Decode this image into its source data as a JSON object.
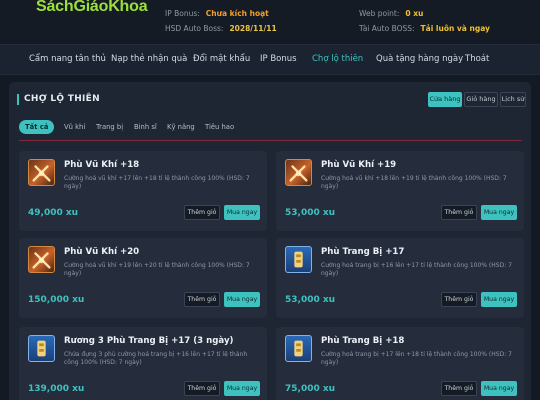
{
  "header": {
    "logo_text": "SáchGiáoKhoa",
    "ip_bonus_label": "IP Bonus:",
    "ip_bonus_value": "Chưa kích hoạt",
    "hsd_label": "HSD Auto Boss:",
    "hsd_value": "2028/11/11",
    "webpoint_label": "Web point:",
    "webpoint_value": "0 xu",
    "autoboss_label": "Tài Auto BOSS:",
    "autoboss_value": "Tải luôn và ngay"
  },
  "nav": {
    "items": [
      "Cẩm nang tân thủ",
      "Nạp thẻ nhận quà",
      "Đổi mật khẩu",
      "IP Bonus",
      "Chợ lộ thiên",
      "Quà tặng hàng ngày",
      "Thoát"
    ],
    "active": "Chợ lộ thiên"
  },
  "market": {
    "title": "CHỢ LỘ THIÊN",
    "tabs": [
      "Cửa hàng",
      "Giỏ hàng",
      "Lịch sử"
    ],
    "active_tab": "Cửa hàng",
    "filters": [
      "Tất cả",
      "Vũ khí",
      "Trang bị",
      "Binh sĩ",
      "Kỹ năng",
      "Tiêu hao"
    ],
    "active_filter": "Tất cả",
    "add_to_cart_label": "Thêm giỏ",
    "buy_label": "Mua ngay",
    "items": [
      {
        "name": "Phù Vũ Khí +18",
        "desc": "Cường hoá vũ khí +17 lên +18 tỉ lệ thành công 100% (HSD: 7 ngày)",
        "price": "49,000 xu",
        "icon": "sword-icon"
      },
      {
        "name": "Phù Vũ Khí +19",
        "desc": "Cường hoá vũ khí +18 lên +19 tỉ lệ thành công 100% (HSD: 7 ngày)",
        "price": "53,000 xu",
        "icon": "sword-icon"
      },
      {
        "name": "Phù Vũ Khí +20",
        "desc": "Cường hoá vũ khí +19 lên +20 tỉ lệ thành công 100% (HSD: 7 ngày)",
        "price": "150,000 xu",
        "icon": "sword-icon"
      },
      {
        "name": "Phù Trang Bị +17",
        "desc": "Cường hoá trang bị +16 lên +17 tỉ lệ thành công 100% (HSD: 7 ngày)",
        "price": "53,000 xu",
        "icon": "armor-icon"
      },
      {
        "name": "Rương 3 Phù Trang Bị +17 (3 ngày)",
        "desc": "Chứa đựng 3 phù cường hoá trang bị +16 lên +17 tỉ lệ thành công 100% (HSD: 7 ngày)",
        "price": "139,000 xu",
        "icon": "armor-icon"
      },
      {
        "name": "Phù Trang Bị +18",
        "desc": "Cường hoá trang bị +17 lên +18 tỉ lệ thành công 100% (HSD: 7 ngày)",
        "price": "75,000 xu",
        "icon": "armor-icon"
      }
    ]
  }
}
